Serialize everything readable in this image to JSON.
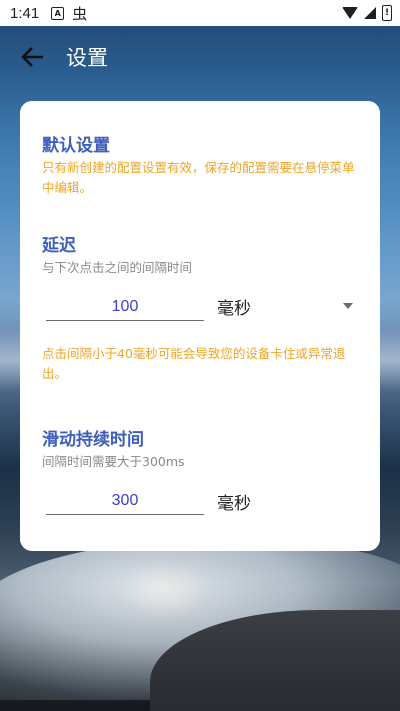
{
  "status_bar": {
    "time": "1:41",
    "icon_a": "A",
    "icon_bug": "虫",
    "icons": [
      "a-notification-icon",
      "bug-notification-icon",
      "wifi-icon",
      "signal-icon",
      "battery-icon"
    ],
    "battery_label": "!"
  },
  "app_bar": {
    "title": "设置",
    "back_icon": "arrow-left-icon"
  },
  "card": {
    "default_section": {
      "title": "默认设置",
      "warning": "只有新创建的配置设置有效，保存的配置需要在悬停菜单中编辑。"
    },
    "delay_section": {
      "title": "延迟",
      "subtitle": "与下次点击之间的间隔时间",
      "value": "100",
      "unit": "毫秒",
      "warning": "点击间隔小于40毫秒可能会导致您的设备卡住或异常退出。"
    },
    "swipe_section": {
      "title": "滑动持续时间",
      "subtitle": "间隔时间需要大于300ms",
      "value": "300",
      "unit": "毫秒"
    }
  },
  "colors": {
    "accent": "#3d5ebd",
    "warning": "#f0a526",
    "input_text": "#3d3dc8",
    "subtitle": "#8a8a8a"
  }
}
